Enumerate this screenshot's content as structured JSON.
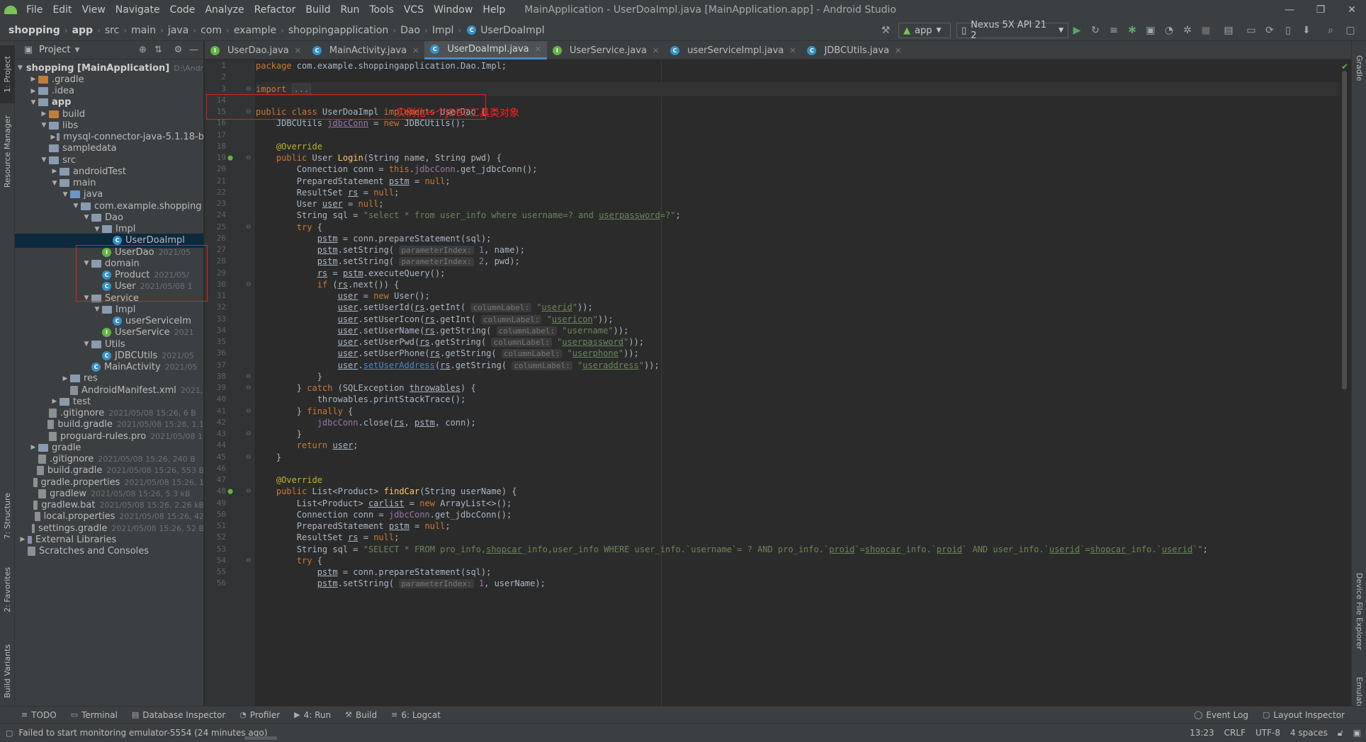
{
  "menubar": {
    "items": [
      "File",
      "Edit",
      "View",
      "Navigate",
      "Code",
      "Analyze",
      "Refactor",
      "Build",
      "Run",
      "Tools",
      "VCS",
      "Window",
      "Help"
    ],
    "title": "MainApplication - UserDoaImpl.java [MainApplication.app] - Android Studio",
    "min": "—",
    "max": "❐",
    "close": "✕"
  },
  "breadcrumb": [
    "shopping",
    "app",
    "src",
    "main",
    "java",
    "com",
    "example",
    "shoppingapplication",
    "Dao",
    "Impl",
    "UserDoaImpl"
  ],
  "toolbar": {
    "run_config": "app",
    "device": "Nexus 5X API 21 2"
  },
  "left_tabs": [
    "1: Project",
    "Resource Manager",
    "7: Structure",
    "2: Favorites",
    "Build Variants"
  ],
  "right_tabs": [
    "Gradle",
    "Device File Explorer",
    "Emulator"
  ],
  "project_panel": {
    "title": "Project"
  },
  "tree": [
    {
      "label": "shopping [MainApplication]",
      "meta": "D:\\Andro",
      "depth": 0,
      "arrow": "▼",
      "icon": "folder",
      "bold": true
    },
    {
      "label": ".gradle",
      "meta": "",
      "depth": 1,
      "arrow": "▶",
      "icon": "folder-orange"
    },
    {
      "label": ".idea",
      "meta": "",
      "depth": 1,
      "arrow": "▶",
      "icon": "folder"
    },
    {
      "label": "app",
      "meta": "",
      "depth": 1,
      "arrow": "▼",
      "icon": "folder",
      "bold": true
    },
    {
      "label": "build",
      "meta": "",
      "depth": 2,
      "arrow": "▶",
      "icon": "folder-orange"
    },
    {
      "label": "libs",
      "meta": "",
      "depth": 2,
      "arrow": "▼",
      "icon": "folder"
    },
    {
      "label": "mysql-connector-java-5.1.18-b",
      "meta": "",
      "depth": 3,
      "arrow": "▶",
      "icon": "lib"
    },
    {
      "label": "sampledata",
      "meta": "",
      "depth": 2,
      "arrow": "",
      "icon": "folder"
    },
    {
      "label": "src",
      "meta": "",
      "depth": 2,
      "arrow": "▼",
      "icon": "folder"
    },
    {
      "label": "androidTest",
      "meta": "",
      "depth": 3,
      "arrow": "▶",
      "icon": "folder"
    },
    {
      "label": "main",
      "meta": "",
      "depth": 3,
      "arrow": "▼",
      "icon": "folder"
    },
    {
      "label": "java",
      "meta": "",
      "depth": 4,
      "arrow": "▼",
      "icon": "folder-blue"
    },
    {
      "label": "com.example.shopping",
      "meta": "",
      "depth": 5,
      "arrow": "▼",
      "icon": "folder"
    },
    {
      "label": "Dao",
      "meta": "",
      "depth": 6,
      "arrow": "▼",
      "icon": "folder"
    },
    {
      "label": "Impl",
      "meta": "",
      "depth": 7,
      "arrow": "▼",
      "icon": "folder"
    },
    {
      "label": "UserDoaImpl",
      "meta": "",
      "depth": 8,
      "arrow": "",
      "icon": "class",
      "selected": true
    },
    {
      "label": "UserDao",
      "meta": "2021/05",
      "depth": 7,
      "arrow": "",
      "icon": "interface"
    },
    {
      "label": "domain",
      "meta": "",
      "depth": 6,
      "arrow": "▼",
      "icon": "folder"
    },
    {
      "label": "Product",
      "meta": "2021/05/",
      "depth": 7,
      "arrow": "",
      "icon": "class"
    },
    {
      "label": "User",
      "meta": "2021/05/08 1",
      "depth": 7,
      "arrow": "",
      "icon": "class"
    },
    {
      "label": "Service",
      "meta": "",
      "depth": 6,
      "arrow": "▼",
      "icon": "folder"
    },
    {
      "label": "Impl",
      "meta": "",
      "depth": 7,
      "arrow": "▼",
      "icon": "folder"
    },
    {
      "label": "userServiceIm",
      "meta": "",
      "depth": 8,
      "arrow": "",
      "icon": "class"
    },
    {
      "label": "UserService",
      "meta": "2021",
      "depth": 7,
      "arrow": "",
      "icon": "interface"
    },
    {
      "label": "Utils",
      "meta": "",
      "depth": 6,
      "arrow": "▼",
      "icon": "folder"
    },
    {
      "label": "JDBCUtils",
      "meta": "2021/05",
      "depth": 7,
      "arrow": "",
      "icon": "class"
    },
    {
      "label": "MainActivity",
      "meta": "2021/05",
      "depth": 6,
      "arrow": "",
      "icon": "class"
    },
    {
      "label": "res",
      "meta": "",
      "depth": 4,
      "arrow": "▶",
      "icon": "folder"
    },
    {
      "label": "AndroidManifest.xml",
      "meta": "2021,",
      "depth": 4,
      "arrow": "",
      "icon": "file"
    },
    {
      "label": "test",
      "meta": "",
      "depth": 3,
      "arrow": "▶",
      "icon": "folder"
    },
    {
      "label": ".gitignore",
      "meta": "2021/05/08 15:26, 6 B",
      "depth": 2,
      "arrow": "",
      "icon": "file"
    },
    {
      "label": "build.gradle",
      "meta": "2021/05/08 15:28, 1.1",
      "depth": 2,
      "arrow": "",
      "icon": "file"
    },
    {
      "label": "proguard-rules.pro",
      "meta": "2021/05/08 1",
      "depth": 2,
      "arrow": "",
      "icon": "file"
    },
    {
      "label": "gradle",
      "meta": "",
      "depth": 1,
      "arrow": "▶",
      "icon": "folder"
    },
    {
      "label": ".gitignore",
      "meta": "2021/05/08 15:26, 240 B",
      "depth": 1,
      "arrow": "",
      "icon": "file"
    },
    {
      "label": "build.gradle",
      "meta": "2021/05/08 15:26, 553 B",
      "depth": 1,
      "arrow": "",
      "icon": "file"
    },
    {
      "label": "gradle.properties",
      "meta": "2021/05/08 15:26, 1",
      "depth": 1,
      "arrow": "",
      "icon": "file"
    },
    {
      "label": "gradlew",
      "meta": "2021/05/08 15:26, 5.3 kB",
      "depth": 1,
      "arrow": "",
      "icon": "file"
    },
    {
      "label": "gradlew.bat",
      "meta": "2021/05/08 15:26, 2.26 kB",
      "depth": 1,
      "arrow": "",
      "icon": "file"
    },
    {
      "label": "local.properties",
      "meta": "2021/05/08 15:26, 42",
      "depth": 1,
      "arrow": "",
      "icon": "file"
    },
    {
      "label": "settings.gradle",
      "meta": "2021/05/08 15:26, 52 B",
      "depth": 1,
      "arrow": "",
      "icon": "file"
    },
    {
      "label": "External Libraries",
      "meta": "",
      "depth": 0,
      "arrow": "▶",
      "icon": "lib"
    },
    {
      "label": "Scratches and Consoles",
      "meta": "",
      "depth": 0,
      "arrow": "",
      "icon": "file"
    }
  ],
  "tabs": [
    {
      "label": "UserDao.java",
      "icon": "interface",
      "active": false
    },
    {
      "label": "MainActivity.java",
      "icon": "class",
      "active": false
    },
    {
      "label": "UserDoaImpl.java",
      "icon": "class",
      "active": true
    },
    {
      "label": "UserService.java",
      "icon": "interface",
      "active": false
    },
    {
      "label": "userServiceImpl.java",
      "icon": "class",
      "active": false
    },
    {
      "label": "JDBCUtils.java",
      "icon": "class",
      "active": false
    }
  ],
  "line_numbers": [
    "1",
    "2",
    "3",
    "14",
    "15",
    "16",
    "17",
    "18",
    "19",
    "20",
    "21",
    "22",
    "23",
    "24",
    "25",
    "26",
    "27",
    "28",
    "29",
    "30",
    "31",
    "32",
    "33",
    "34",
    "35",
    "36",
    "37",
    "38",
    "39",
    "40",
    "41",
    "42",
    "43",
    "44",
    "45",
    "46",
    "47",
    "48",
    "49",
    "50",
    "51",
    "52",
    "53",
    "54",
    "55",
    "56"
  ],
  "code_lines": [
    "<span class=\"kw\">package</span> com.example.shoppingapplication.Dao.Impl;",
    "",
    "<span class=\"kw\">import</span> <span class=\"fold-ph\">...</span>",
    "",
    "<span class=\"kw\">public class</span> UserDoaImpl <span class=\"kw\">implements</span> UserDao {",
    "    JDBCUtils <span class=\"fld ul\">jdbcConn</span> = <span class=\"kw\">new</span> JDBCUtils();",
    "",
    "    <span class=\"an\">@Override</span>",
    "    <span class=\"kw\">public</span> User <span class=\"fn\">Login</span>(String name, String pwd) {",
    "        Connection conn = <span class=\"kw\">this</span>.<span class=\"fld\">jdbcConn</span>.get_jdbcConn();",
    "        PreparedStatement <span class=\"ul\">pstm</span> = <span class=\"kw\">null</span>;",
    "        ResultSet <span class=\"ul\">rs</span> = <span class=\"kw\">null</span>;",
    "        User <span class=\"ul\">user</span> = <span class=\"kw\">null</span>;",
    "        String sql = <span class=\"str\">\"select * from user_info where username=? and <span class=\"ul\">userpassword</span>=?\"</span>;",
    "        <span class=\"kw\">try</span> {",
    "            <span class=\"ul\">pstm</span> = conn.prepareStatement(sql);",
    "            <span class=\"ul\">pstm</span>.setString( <span class=\"hint\">parameterIndex:</span> <span class=\"fld\">1</span>, name);",
    "            <span class=\"ul\">pstm</span>.setString( <span class=\"hint\">parameterIndex:</span> <span class=\"fld\">2</span>, pwd);",
    "            <span class=\"ul\">rs</span> = <span class=\"ul\">pstm</span>.executeQuery();",
    "            <span class=\"kw\">if</span> (<span class=\"ul\">rs</span>.next()) {",
    "                <span class=\"ul\">user</span> = <span class=\"kw\">new</span> User();",
    "                <span class=\"ul\">user</span>.setUserId(<span class=\"ul\">rs</span>.getInt( <span class=\"hint\">columnLabel:</span> <span class=\"str\">\"<span class=\"ul\">userid</span>\"</span>));",
    "                <span class=\"ul\">user</span>.setUserIcon(<span class=\"ul\">rs</span>.getInt( <span class=\"hint\">columnLabel:</span> <span class=\"str\">\"<span class=\"ul\">usericon</span>\"</span>));",
    "                <span class=\"ul\">user</span>.setUserName(<span class=\"ul\">rs</span>.getString( <span class=\"hint\">columnLabel:</span> <span class=\"str\">\"username\"</span>));",
    "                <span class=\"ul\">user</span>.setUserPwd(<span class=\"ul\">rs</span>.getString( <span class=\"hint\">columnLabel:</span> <span class=\"str\">\"<span class=\"ul\">userpassword</span>\"</span>));",
    "                <span class=\"ul\">user</span>.setUserPhone(<span class=\"ul\">rs</span>.getString( <span class=\"hint\">columnLabel:</span> <span class=\"str\">\"<span class=\"ul\">userphone</span>\"</span>));",
    "                <span class=\"ul\">user</span>.<span class=\"link\">setUserAddress</span>(<span class=\"ul\">rs</span>.getString( <span class=\"hint\">columnLabel:</span> <span class=\"str\">\"<span class=\"ul\">useraddress</span>\"</span>));",
    "            }",
    "        } <span class=\"kw\">catch</span> (SQLException <span class=\"ul\">throwables</span>) {",
    "            throwables.printStackTrace();",
    "        } <span class=\"kw\">finally</span> {",
    "            <span class=\"fld\">jdbcConn</span>.close(<span class=\"ul\">rs</span>, <span class=\"ul\">pstm</span>, conn);",
    "        }",
    "        <span class=\"kw\">return</span> <span class=\"ul\">user</span>;",
    "    }",
    "",
    "    <span class=\"an\">@Override</span>",
    "    <span class=\"kw\">public</span> List&lt;Product&gt; <span class=\"fn\">findCar</span>(String userName) {",
    "        List&lt;Product&gt; <span class=\"ul\">carlist</span> = <span class=\"kw\">new</span> ArrayList&lt;&gt;();",
    "        Connection conn = <span class=\"fld\">jdbcConn</span>.get_jdbcConn();",
    "        PreparedStatement <span class=\"ul\">pstm</span> = <span class=\"kw\">null</span>;",
    "        ResultSet <span class=\"ul\">rs</span> = <span class=\"kw\">null</span>;",
    "        String sql = <span class=\"str\">\"SELECT * FROM pro_info,<span class=\"ul\">shopcar</span>_info,user_info WHERE user_info.`username`= ? AND pro_info.`<span class=\"ul\">proid</span>`=<span class=\"ul\">shopcar</span>_info.`<span class=\"ul\">proid</span>` AND user_info.`<span class=\"ul\">userid</span>`=<span class=\"ul\">shopcar</span>_info.`<span class=\"ul\">userid</span>`\"</span>;",
    "        <span class=\"kw\">try</span> {",
    "            <span class=\"ul\">pstm</span> = conn.prepareStatement(sql);",
    "            <span class=\"ul\">pstm</span>.setString( <span class=\"hint\">parameterIndex:</span> <span class=\"fld\">1</span>, userName);"
  ],
  "annotation": {
    "note": "实例化一个JDBC工具类对象"
  },
  "bottom_tools": [
    "TODO",
    "Terminal",
    "Database Inspector",
    "Profiler",
    "4: Run",
    "Build",
    "6: Logcat"
  ],
  "bottom_right_tools": [
    "Event Log",
    "Layout Inspector"
  ],
  "status": {
    "message": "Failed to start monitoring emulator-5554 (24 minutes ago)",
    "position": "13:23",
    "line_sep": "CRLF",
    "encoding": "UTF-8",
    "indent": "4 spaces"
  },
  "colors": {
    "accent": "#4a88c7",
    "annotation": "#ff2222",
    "bg": "#2b2b2b",
    "panel": "#3c3f41"
  }
}
